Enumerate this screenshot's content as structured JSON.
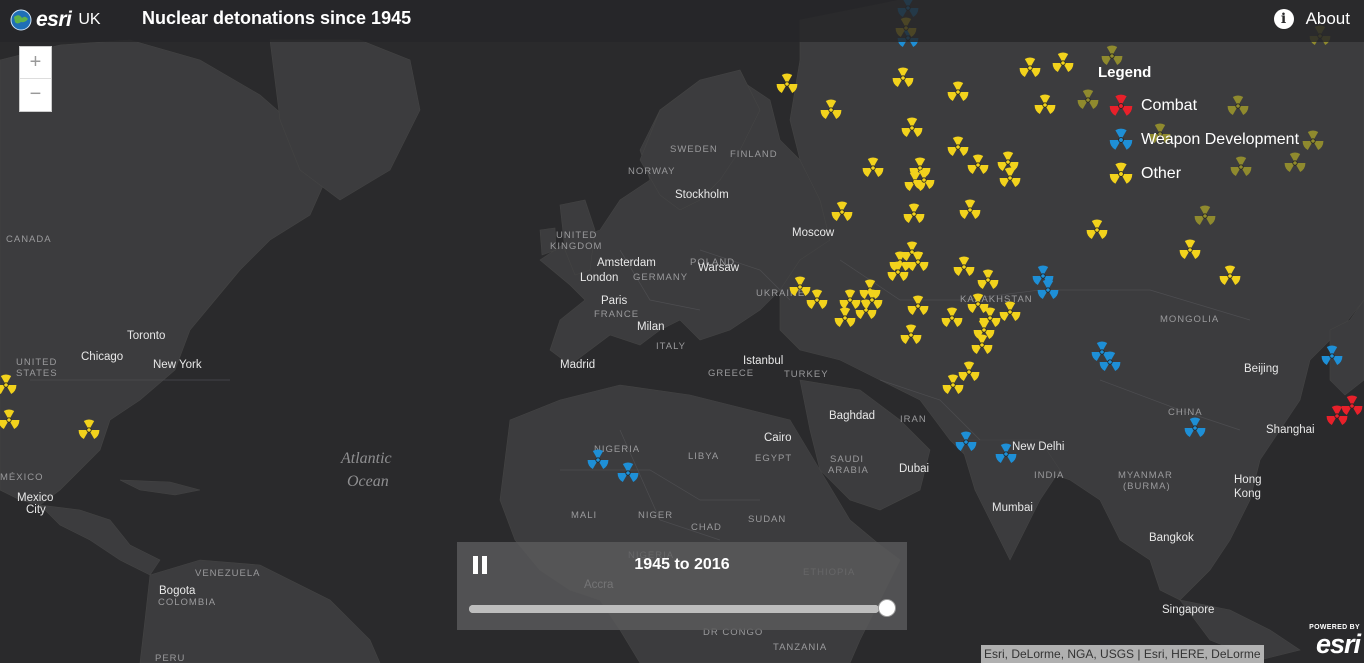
{
  "header": {
    "logo_text": "esri",
    "logo_sub": "UK",
    "title": "Nuclear detonations since 1945",
    "about_label": "About"
  },
  "zoom": {
    "in_label": "+",
    "out_label": "−"
  },
  "legend": {
    "title": "Legend",
    "items": [
      {
        "label": "Combat",
        "color": "#e8202a"
      },
      {
        "label": "Weapon Development",
        "color": "#1e8fd6"
      },
      {
        "label": "Other",
        "color": "#f2d21c"
      }
    ]
  },
  "timeline": {
    "range_label": "1945 to 2016",
    "progress": 1.0,
    "start_year": 1945,
    "end_year": 2016
  },
  "attribution": "Esri, DeLorme, NGA, USGS | Esri, HERE, DeLorme",
  "powered_by": {
    "line1": "POWERED BY",
    "line2": "esri"
  },
  "map_labels": {
    "cities": [
      "Stockholm",
      "Moscow",
      "Amsterdam",
      "London",
      "Warsaw",
      "Paris",
      "Milan",
      "Madrid",
      "Istanbul",
      "Toronto",
      "Chicago",
      "New York",
      "Mexico City",
      "Bogota",
      "Accra",
      "Cairo",
      "Baghdad",
      "Dubai",
      "New Delhi",
      "Mumbai",
      "Beijing",
      "Shanghai",
      "Hong Kong",
      "Bangkok",
      "Singapore"
    ],
    "countries": [
      "SWEDEN",
      "FINLAND",
      "NORWAY",
      "UNITED KINGDOM",
      "GERMANY",
      "POLAND",
      "UKRAINE",
      "FRANCE",
      "ITALY",
      "GREECE",
      "TURKEY",
      "KAZAKHSTAN",
      "MONGOLIA",
      "IRAN",
      "CHINA",
      "INDIA",
      "MYANMAR (BURMA)",
      "SAUDI ARABIA",
      "EGYPT",
      "LIBYA",
      "NIGERIA",
      "MALI",
      "NIGER",
      "CHAD",
      "SUDAN",
      "ETHIOPIA",
      "DR CONGO",
      "TANZANIA",
      "VENEZUELA",
      "COLOMBIA",
      "PERU",
      "CANADA",
      "UNITED STATES",
      "MEXICO"
    ],
    "ocean": [
      "Atlantic",
      "Ocean"
    ]
  },
  "icon": "radiation-trefoil-icon"
}
